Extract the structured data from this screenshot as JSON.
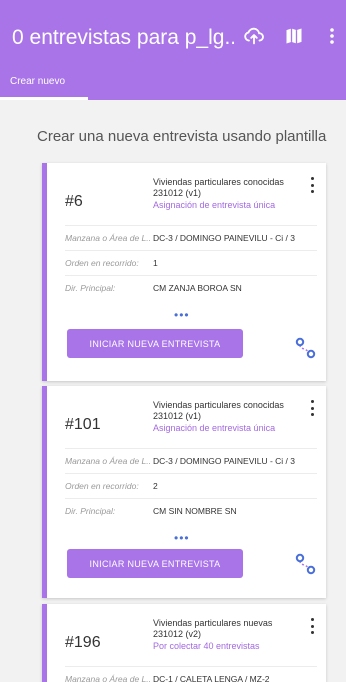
{
  "appbar": {
    "title": "0 entrevistas para p_lg...",
    "icons": [
      "cloud-sync-icon",
      "map-icon",
      "more-vert-icon"
    ]
  },
  "tabs": [
    {
      "label": "Crear nuevo",
      "selected": true
    }
  ],
  "section_title": "Crear una nueva entrevista usando plantilla",
  "colors": {
    "accent": "#a874e8",
    "link": "#a36ae0",
    "dots": "#4a6fd8"
  },
  "cards": [
    {
      "number": "#6",
      "template": "Viviendas particulares conocidas 231012 (v1)",
      "subtitle": "Asignación de entrevista única",
      "rows": [
        {
          "label": "Manzana o Área de L...",
          "value": "DC-3 / DOMINGO PAINEVILU - Ci / 3"
        },
        {
          "label": "Orden en recorrido:",
          "value": "1"
        },
        {
          "label": "Dir. Principal:",
          "value": "CM ZANJA BOROA SN"
        }
      ],
      "more": "•••",
      "button": "INICIAR NUEVA ENTREVISTA"
    },
    {
      "number": "#101",
      "template": "Viviendas particulares conocidas 231012 (v1)",
      "subtitle": "Asignación de entrevista única",
      "rows": [
        {
          "label": "Manzana o Área de L...",
          "value": "DC-3 / DOMINGO PAINEVILU - Ci / 3"
        },
        {
          "label": "Orden en recorrido:",
          "value": "2"
        },
        {
          "label": "Dir. Principal:",
          "value": "CM SIN NOMBRE SN"
        }
      ],
      "more": "•••",
      "button": "INICIAR NUEVA ENTREVISTA"
    },
    {
      "number": "#196",
      "template": "Viviendas particulares nuevas 231012 (v2)",
      "subtitle": "Por colectar 40 entrevistas",
      "rows": [
        {
          "label": "Manzana o Área de L...",
          "value": "DC-1 / CALETA LENGA / MZ-2"
        }
      ]
    }
  ]
}
